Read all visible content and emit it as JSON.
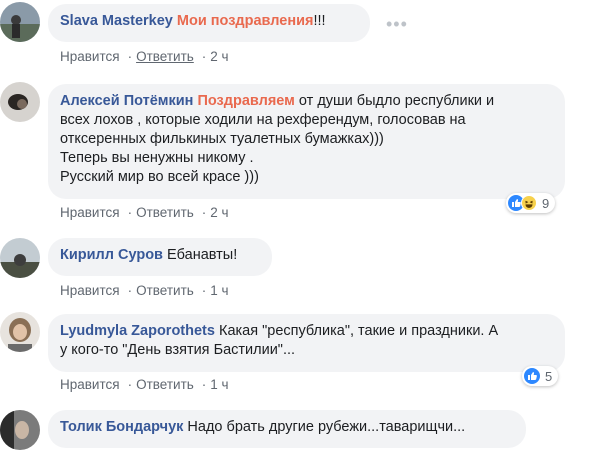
{
  "comments": [
    {
      "author": "Slava Masterkey",
      "highlight": "Мои поздравления",
      "text": "!!!",
      "like_label": "Нравится",
      "reply_label": "Ответить",
      "time": "2 ч"
    },
    {
      "author": "Алексей Потёмкин",
      "highlight": "Поздравляем",
      "text": " от души быдло республики и\nвсех лохов , которые ходили на рехферендум, голосовав на\nотксеренных филькиных туалетных бумажках)))\nТеперь вы ненужны никому .\nРусский мир во всей красе )))",
      "like_label": "Нравится",
      "reply_label": "Ответить",
      "time": "2 ч",
      "reaction_count": "9"
    },
    {
      "author": "Кирилл Суров",
      "text": "Ебанавты!",
      "like_label": "Нравится",
      "reply_label": "Ответить",
      "time": "1 ч"
    },
    {
      "author": "Lyudmyla Zaporothets",
      "text": " Какая \"республика\", такие и праздники. А\nу кого-то \"День взятия Бастилии\"...",
      "like_label": "Нравится",
      "reply_label": "Ответить",
      "time": "1 ч",
      "reaction_count": "5"
    },
    {
      "author": "Толик Бондарчук",
      "text": " Надо брать другие рубежи...таварищчи..."
    }
  ]
}
